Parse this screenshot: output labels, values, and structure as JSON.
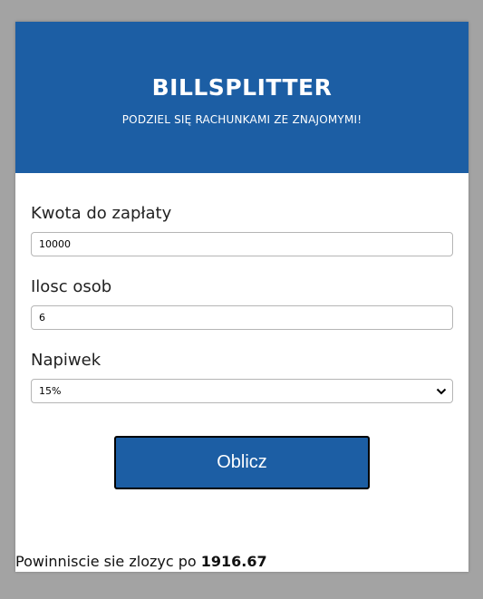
{
  "header": {
    "title": "BILLSPLITTER",
    "subtitle": "PODZIEL SIĘ RACHUNKAMI ZE ZNAJOMYMI!"
  },
  "form": {
    "amount_label": "Kwota do zapłaty",
    "amount_value": "10000",
    "people_label": "Ilosc osob",
    "people_value": "6",
    "tip_label": "Napiwek",
    "tip_value": "15%"
  },
  "button": {
    "label": "Oblicz"
  },
  "result": {
    "prefix": "Powinniscie sie zlozyc po ",
    "value": "1916.67"
  },
  "colors": {
    "primary": "#1c5ea4",
    "background": "#a3a3a3"
  },
  "icons": {
    "select_arrow": "chevron-down-icon"
  }
}
